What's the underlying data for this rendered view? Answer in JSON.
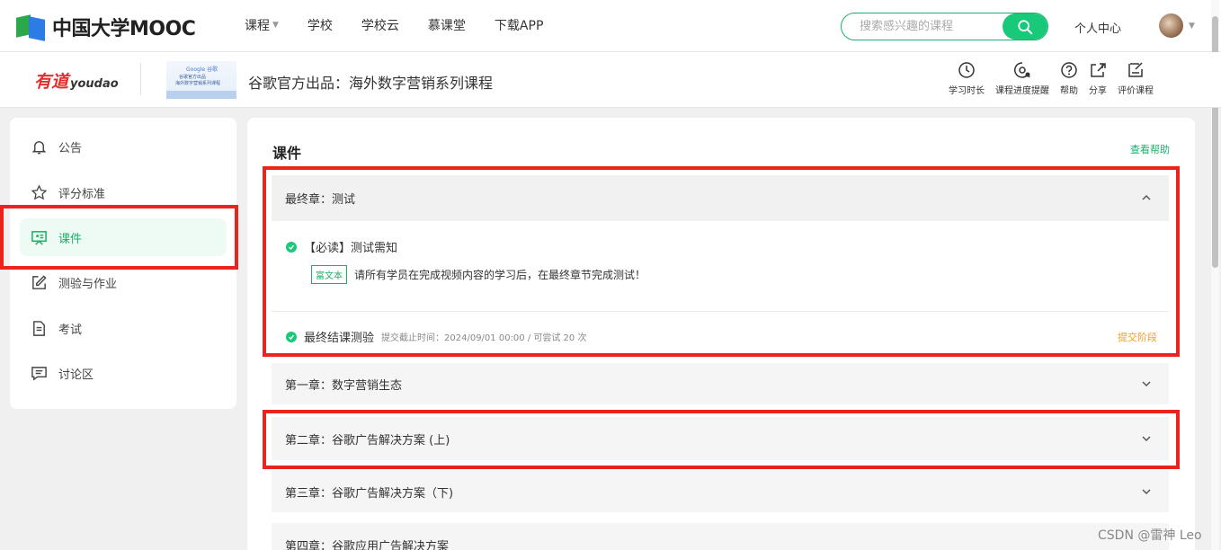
{
  "header": {
    "logo_text": "中国大学MOOC",
    "nav": [
      {
        "label": "课程",
        "dropdown": true
      },
      {
        "label": "学校",
        "dropdown": false
      },
      {
        "label": "学校云",
        "dropdown": false
      },
      {
        "label": "慕课堂",
        "dropdown": false
      },
      {
        "label": "下载APP",
        "dropdown": false
      }
    ],
    "search_placeholder": "搜索感兴趣的课程",
    "personal_center": "个人中心"
  },
  "course": {
    "partner_cn": "有道",
    "partner_en": "youdao",
    "thumb_line1": "Google 谷歌",
    "thumb_line2": "谷歌官方出品",
    "thumb_line3": "海外数字营销系列课程",
    "title": "谷歌官方出品：海外数字营销系列课程",
    "tools": [
      {
        "label": "学习时长",
        "icon": "clock-icon"
      },
      {
        "label": "课程进度提醒",
        "icon": "progress-reminder-icon"
      },
      {
        "label": "帮助",
        "icon": "help-icon"
      },
      {
        "label": "分享",
        "icon": "share-icon"
      },
      {
        "label": "评价课程",
        "icon": "review-icon"
      }
    ]
  },
  "sidebar": {
    "items": [
      {
        "label": "公告",
        "icon": "bell-icon",
        "active": false
      },
      {
        "label": "评分标准",
        "icon": "star-icon",
        "active": false
      },
      {
        "label": "课件",
        "icon": "courseware-icon",
        "active": true
      },
      {
        "label": "测验与作业",
        "icon": "edit-icon",
        "active": false
      },
      {
        "label": "考试",
        "icon": "document-icon",
        "active": false
      },
      {
        "label": "讨论区",
        "icon": "chat-icon",
        "active": false
      }
    ]
  },
  "main": {
    "title": "课件",
    "help_link": "查看帮助",
    "expanded_chapter": {
      "title": "最终章：测试",
      "item1_label": "【必读】测试需知",
      "item1_tag": "富文本",
      "item1_desc": "请所有学员在完成视频内容的学习后，在最终章节完成测试！",
      "item2_label": "最终结课测验",
      "item2_meta": "提交截止时间：2024/09/01 00:00 / 可尝试 20 次",
      "item2_stage": "提交阶段"
    },
    "chapters": [
      "第一章：数字营销生态",
      "第二章：谷歌广告解决方案 (上)",
      "第三章：谷歌广告解决方案（下)",
      "第四章：谷歌应用广告解决方案"
    ]
  },
  "watermark": "CSDN @雷神 Leo",
  "colors": {
    "accent": "#19b16b",
    "annotation_red": "#e8241c",
    "stage_orange": "#f0a020"
  }
}
